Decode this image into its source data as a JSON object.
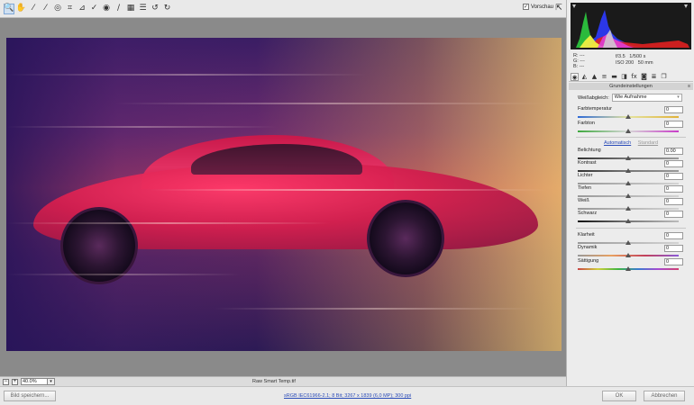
{
  "toolbar": {
    "tools": [
      {
        "name": "zoom-tool",
        "glyph": "🔍",
        "active": true
      },
      {
        "name": "hand-tool",
        "glyph": "✋"
      },
      {
        "name": "white-balance-tool",
        "glyph": "⁄"
      },
      {
        "name": "color-sampler-tool",
        "glyph": "⁄"
      },
      {
        "name": "targeted-adjustment-tool",
        "glyph": "◎"
      },
      {
        "name": "crop-tool",
        "glyph": "⌗"
      },
      {
        "name": "straighten-tool",
        "glyph": "⊿"
      },
      {
        "name": "spot-removal-tool",
        "glyph": "✓"
      },
      {
        "name": "red-eye-tool",
        "glyph": "◉"
      },
      {
        "name": "adjustment-brush-tool",
        "glyph": "∕"
      },
      {
        "name": "graduated-filter-tool",
        "glyph": "▦"
      },
      {
        "name": "preferences-tool",
        "glyph": "☰"
      },
      {
        "name": "rotate-left-tool",
        "glyph": "↺"
      },
      {
        "name": "rotate-right-tool",
        "glyph": "↻"
      }
    ],
    "preview_label": "Vorschau",
    "preview_checked": "✓",
    "fullscreen_glyph": "⇱"
  },
  "statusbar": {
    "zoom_out": "−",
    "zoom_in": "+",
    "zoom_value": "40.0%",
    "zoom_dropdown": "▾",
    "filename": "Raw Smart Temp.tif"
  },
  "footer": {
    "save_label": "Bild speichern...",
    "info_link": "sRGB IEC61966-2.1; 8 Bit; 3267 x 1839 (6,0 MP); 300 ppi",
    "ok_label": "OK",
    "cancel_label": "Abbrechen"
  },
  "info": {
    "r_label": "R:",
    "g_label": "G:",
    "b_label": "B:",
    "r_value": "---",
    "g_value": "---",
    "b_value": "---",
    "aperture": "f/3.5",
    "shutter": "1/500 s",
    "iso": "ISO 200",
    "focal": "50 mm"
  },
  "panel": {
    "tabs": [
      "◉",
      "◭",
      "▲",
      "≡",
      "▬",
      "◨",
      "fx",
      "◙",
      "≣",
      "❐"
    ],
    "section_title": "Grundeinstellungen",
    "section_menu": "≡",
    "wb_label": "Weißabgleich:",
    "wb_value": "Wie Aufnahme",
    "wb_arrow": "▾",
    "auto_label": "Automatisch",
    "standard_label": "Standard",
    "sliders": {
      "temp": {
        "label": "Farbtemperatur",
        "value": "0",
        "pos": 0.5
      },
      "tint": {
        "label": "Farbton",
        "value": "0",
        "pos": 0.5
      },
      "exposure": {
        "label": "Belichtung",
        "value": "0.00",
        "pos": 0.5
      },
      "contrast": {
        "label": "Kontrast",
        "value": "0",
        "pos": 0.5
      },
      "highlights": {
        "label": "Lichter",
        "value": "0",
        "pos": 0.5
      },
      "shadows": {
        "label": "Tiefen",
        "value": "0",
        "pos": 0.5
      },
      "whites": {
        "label": "Weiß",
        "value": "0",
        "pos": 0.5
      },
      "blacks": {
        "label": "Schwarz",
        "value": "0",
        "pos": 0.5
      },
      "clarity": {
        "label": "Klarheit",
        "value": "0",
        "pos": 0.5
      },
      "vibrance": {
        "label": "Dynamik",
        "value": "0",
        "pos": 0.5
      },
      "saturation": {
        "label": "Sättigung",
        "value": "0",
        "pos": 0.5
      }
    }
  },
  "colors": {
    "accent": "#2a4bb8",
    "car": "#d41e4e"
  }
}
